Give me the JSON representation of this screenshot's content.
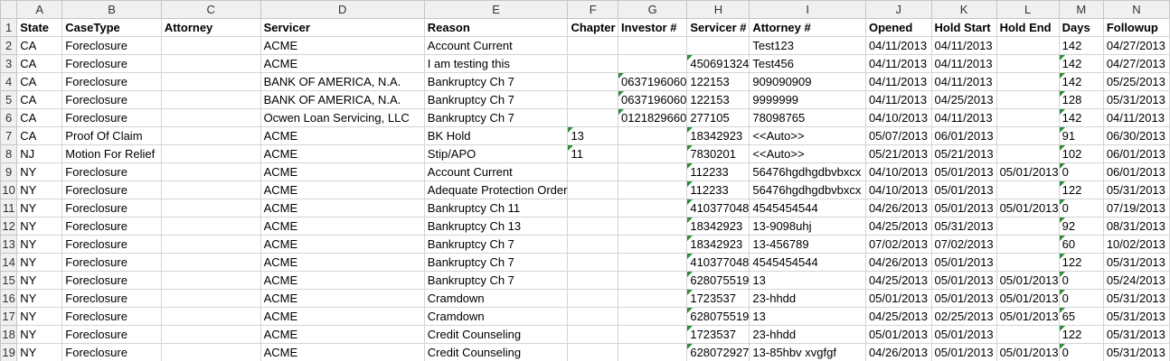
{
  "columns": [
    "A",
    "B",
    "C",
    "D",
    "E",
    "F",
    "G",
    "H",
    "I",
    "J",
    "K",
    "L",
    "M",
    "N"
  ],
  "header_row": [
    "State",
    "CaseType",
    "Attorney",
    "Servicer",
    "Reason",
    "Chapter",
    "Investor #",
    "Servicer #",
    "Attorney #",
    "Opened",
    "Hold Start",
    "Hold End",
    "Days",
    "Followup"
  ],
  "rows": [
    [
      "CA",
      "Foreclosure",
      "",
      "ACME",
      "Account Current",
      "",
      "",
      "",
      "Test123",
      "04/11/2013",
      "04/11/2013",
      "",
      "142",
      "04/27/2013"
    ],
    [
      "CA",
      "Foreclosure",
      "",
      "ACME",
      "I am testing this",
      "",
      "",
      "450691324",
      "Test456",
      "04/11/2013",
      "04/11/2013",
      "",
      "142",
      "04/27/2013"
    ],
    [
      "CA",
      "Foreclosure",
      "",
      "BANK OF AMERICA, N.A.",
      "Bankruptcy Ch 7",
      "",
      "0637196060",
      "122153",
      "909090909",
      "04/11/2013",
      "04/11/2013",
      "",
      "142",
      "05/25/2013"
    ],
    [
      "CA",
      "Foreclosure",
      "",
      "BANK OF AMERICA, N.A.",
      "Bankruptcy Ch 7",
      "",
      "0637196060",
      "122153",
      "9999999",
      "04/11/2013",
      "04/25/2013",
      "",
      "128",
      "05/31/2013"
    ],
    [
      "CA",
      "Foreclosure",
      "",
      "Ocwen Loan Servicing, LLC",
      "Bankruptcy Ch 7",
      "",
      "0121829660",
      "277105",
      "78098765",
      "04/10/2013",
      "04/11/2013",
      "",
      "142",
      "04/11/2013"
    ],
    [
      "CA",
      "Proof Of Claim",
      "",
      "ACME",
      "BK Hold",
      "13",
      "",
      "18342923",
      "<<Auto>>",
      "05/07/2013",
      "06/01/2013",
      "",
      "91",
      "06/30/2013"
    ],
    [
      "NJ",
      "Motion For Relief",
      "",
      "ACME",
      "Stip/APO",
      "11",
      "",
      "7830201",
      "<<Auto>>",
      "05/21/2013",
      "05/21/2013",
      "",
      "102",
      "06/01/2013"
    ],
    [
      "NY",
      "Foreclosure",
      "",
      "ACME",
      "Account Current",
      "",
      "",
      "112233",
      "56476hgdhgdbvbxcx",
      "04/10/2013",
      "05/01/2013",
      "05/01/2013",
      "0",
      "06/01/2013"
    ],
    [
      "NY",
      "Foreclosure",
      "",
      "ACME",
      "Adequate Protection Order",
      "",
      "",
      "112233",
      "56476hgdhgdbvbxcx",
      "04/10/2013",
      "05/01/2013",
      "",
      "122",
      "05/31/2013"
    ],
    [
      "NY",
      "Foreclosure",
      "",
      "ACME",
      "Bankruptcy Ch 11",
      "",
      "",
      "410377048",
      "4545454544",
      "04/26/2013",
      "05/01/2013",
      "05/01/2013",
      "0",
      "07/19/2013"
    ],
    [
      "NY",
      "Foreclosure",
      "",
      "ACME",
      "Bankruptcy Ch 13",
      "",
      "",
      "18342923",
      "13-9098uhj",
      "04/25/2013",
      "05/31/2013",
      "",
      "92",
      "08/31/2013"
    ],
    [
      "NY",
      "Foreclosure",
      "",
      "ACME",
      "Bankruptcy Ch 7",
      "",
      "",
      "18342923",
      "13-456789",
      "07/02/2013",
      "07/02/2013",
      "",
      "60",
      "10/02/2013"
    ],
    [
      "NY",
      "Foreclosure",
      "",
      "ACME",
      "Bankruptcy Ch 7",
      "",
      "",
      "410377048",
      "4545454544",
      "04/26/2013",
      "05/01/2013",
      "",
      "122",
      "05/31/2013"
    ],
    [
      "NY",
      "Foreclosure",
      "",
      "ACME",
      "Bankruptcy Ch 7",
      "",
      "",
      "628075519",
      "13",
      "04/25/2013",
      "05/01/2013",
      "05/01/2013",
      "0",
      "05/24/2013"
    ],
    [
      "NY",
      "Foreclosure",
      "",
      "ACME",
      "Cramdown",
      "",
      "",
      "1723537",
      "23-hhdd",
      "05/01/2013",
      "05/01/2013",
      "05/01/2013",
      "0",
      "05/31/2013"
    ],
    [
      "NY",
      "Foreclosure",
      "",
      "ACME",
      "Cramdown",
      "",
      "",
      "628075519",
      "13",
      "04/25/2013",
      "02/25/2013",
      "05/01/2013",
      "65",
      "05/31/2013"
    ],
    [
      "NY",
      "Foreclosure",
      "",
      "ACME",
      "Credit Counseling",
      "",
      "",
      "1723537",
      "23-hhdd",
      "05/01/2013",
      "05/01/2013",
      "",
      "122",
      "05/31/2013"
    ],
    [
      "NY",
      "Foreclosure",
      "",
      "ACME",
      "Credit Counseling",
      "",
      "",
      "628072927",
      "13-85hbv xvgfgf",
      "04/26/2013",
      "05/01/2013",
      "05/01/2013",
      "0",
      "05/31/2013"
    ]
  ],
  "flags": [
    [
      0,
      0,
      0,
      0,
      0,
      0,
      0,
      0,
      0,
      0,
      0,
      0,
      0,
      0
    ],
    [
      0,
      0,
      0,
      0,
      0,
      0,
      0,
      1,
      0,
      0,
      0,
      0,
      1,
      0
    ],
    [
      0,
      0,
      0,
      0,
      0,
      0,
      1,
      0,
      0,
      0,
      0,
      0,
      1,
      0
    ],
    [
      0,
      0,
      0,
      0,
      0,
      0,
      1,
      0,
      0,
      0,
      0,
      0,
      1,
      0
    ],
    [
      0,
      0,
      0,
      0,
      0,
      0,
      1,
      0,
      0,
      0,
      0,
      0,
      1,
      0
    ],
    [
      0,
      0,
      0,
      0,
      0,
      1,
      0,
      1,
      0,
      0,
      0,
      0,
      1,
      0
    ],
    [
      0,
      0,
      0,
      0,
      0,
      1,
      0,
      1,
      0,
      0,
      0,
      0,
      1,
      0
    ],
    [
      0,
      0,
      0,
      0,
      0,
      0,
      0,
      1,
      0,
      0,
      0,
      0,
      1,
      0
    ],
    [
      0,
      0,
      0,
      0,
      0,
      0,
      0,
      1,
      0,
      0,
      0,
      0,
      1,
      0
    ],
    [
      0,
      0,
      0,
      0,
      0,
      0,
      0,
      1,
      0,
      0,
      0,
      0,
      1,
      0
    ],
    [
      0,
      0,
      0,
      0,
      0,
      0,
      0,
      1,
      0,
      0,
      0,
      0,
      1,
      0
    ],
    [
      0,
      0,
      0,
      0,
      0,
      0,
      0,
      1,
      0,
      0,
      0,
      0,
      1,
      0
    ],
    [
      0,
      0,
      0,
      0,
      0,
      0,
      0,
      1,
      0,
      0,
      0,
      0,
      1,
      0
    ],
    [
      0,
      0,
      0,
      0,
      0,
      0,
      0,
      1,
      0,
      0,
      0,
      0,
      1,
      0
    ],
    [
      0,
      0,
      0,
      0,
      0,
      0,
      0,
      1,
      0,
      0,
      0,
      0,
      1,
      0
    ],
    [
      0,
      0,
      0,
      0,
      0,
      0,
      0,
      1,
      0,
      0,
      0,
      0,
      1,
      0
    ],
    [
      0,
      0,
      0,
      0,
      0,
      0,
      0,
      1,
      0,
      0,
      0,
      0,
      1,
      0
    ],
    [
      0,
      0,
      0,
      0,
      0,
      0,
      0,
      1,
      0,
      0,
      0,
      0,
      1,
      0
    ]
  ],
  "colors": {
    "header_bg": "#f0f0f0",
    "gridline": "#d4d4d4",
    "comment_indicator": "#2e8b3a"
  }
}
